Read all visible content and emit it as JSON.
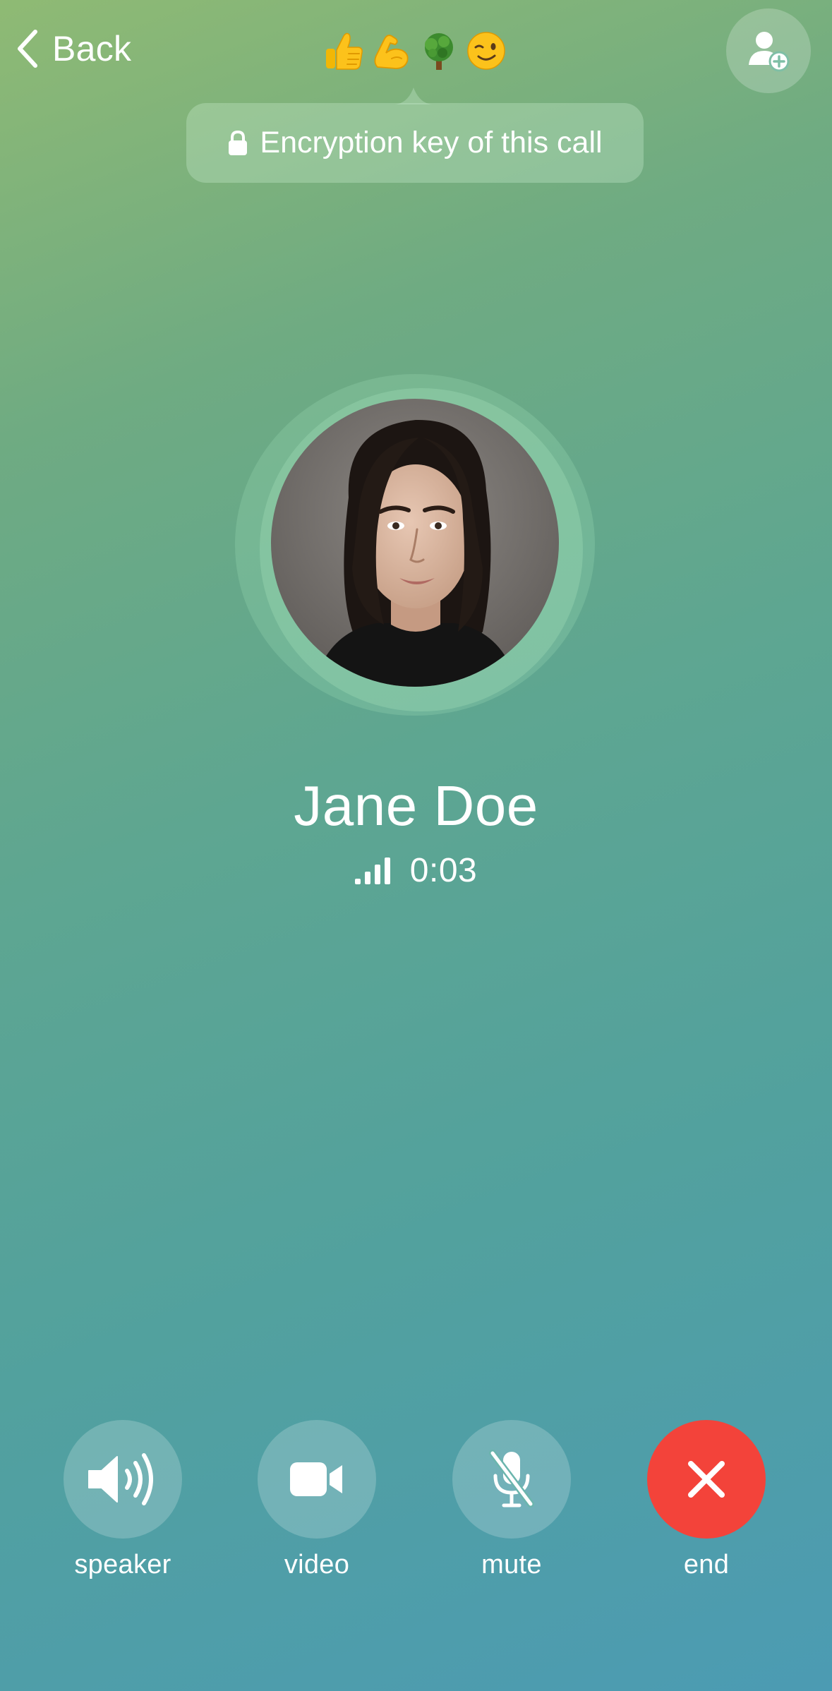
{
  "header": {
    "back_label": "Back",
    "emojis": [
      "thumbs-up",
      "flexed-biceps",
      "deciduous-tree",
      "winking-face"
    ],
    "add_person_icon": "person-add-icon"
  },
  "encryption": {
    "text": "Encryption key of this call"
  },
  "caller": {
    "name": "Jane Doe",
    "duration": "0:03",
    "signal_bars": 4
  },
  "controls": [
    {
      "id": "speaker",
      "label": "speaker",
      "icon": "speaker-icon"
    },
    {
      "id": "video",
      "label": "video",
      "icon": "video-camera-icon"
    },
    {
      "id": "mute",
      "label": "mute",
      "icon": "microphone-muted-icon"
    },
    {
      "id": "end",
      "label": "end",
      "icon": "close-icon"
    }
  ],
  "colors": {
    "end_button": "#f3433a",
    "background_top": "#8fba74",
    "background_bottom": "#4c9bb3"
  }
}
